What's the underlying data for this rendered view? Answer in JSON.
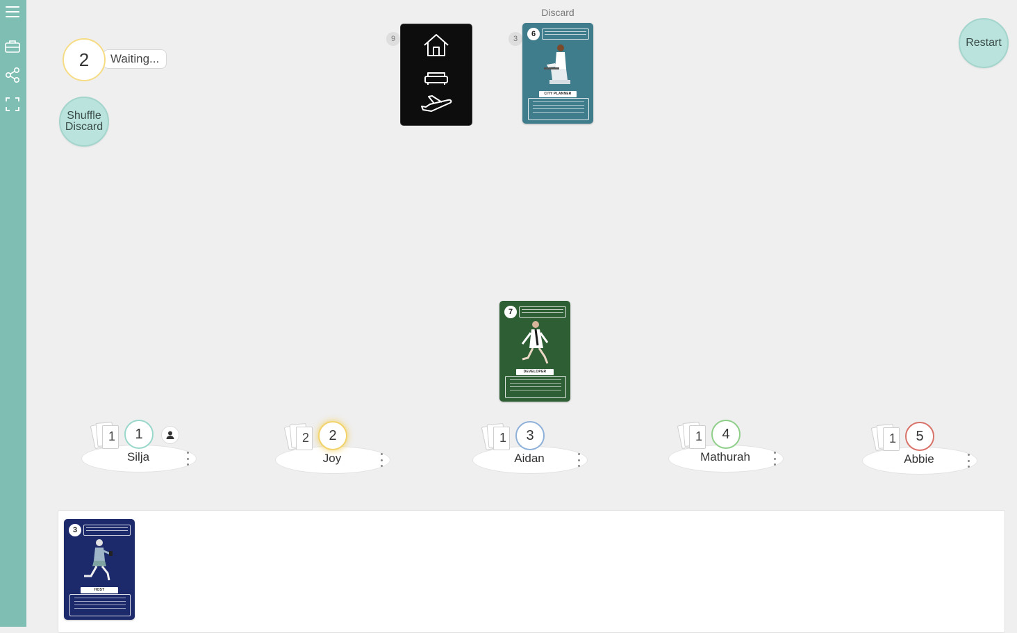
{
  "sidebar": {
    "icons": [
      "menu-icon",
      "briefcase-icon",
      "share-icon",
      "fullscreen-icon"
    ]
  },
  "turn": {
    "number": "2",
    "status": "Waiting..."
  },
  "shuffle_button": "Shuffle\nDiscard",
  "restart_button": "Restart",
  "deck": {
    "count": "9",
    "icons": [
      "house-icon",
      "sofa-icon",
      "airplane-icon"
    ]
  },
  "discard": {
    "label": "Discard",
    "count": "3",
    "card": {
      "number": "6",
      "role": "CITY PLANNER",
      "color": "#3f7c8c"
    }
  },
  "played_card": {
    "number": "7",
    "role": "DEVELOPER",
    "color": "#2e5e33"
  },
  "players": [
    {
      "name": "Silja",
      "cards": "1",
      "seat": "1",
      "ring": "#9ad8cc",
      "you": true
    },
    {
      "name": "Joy",
      "cards": "2",
      "seat": "2",
      "ring": "#f3d36b",
      "you": false
    },
    {
      "name": "Aidan",
      "cards": "1",
      "seat": "3",
      "ring": "#8fb1d9",
      "you": false
    },
    {
      "name": "Mathurah",
      "cards": "1",
      "seat": "4",
      "ring": "#8fcf8a",
      "you": false
    },
    {
      "name": "Abbie",
      "cards": "1",
      "seat": "5",
      "ring": "#d9736a",
      "you": false
    }
  ],
  "my_hand": [
    {
      "number": "3",
      "role": "HOST",
      "color": "#1c2a6b"
    }
  ],
  "colors": {
    "sidebar": "#7fbfb3",
    "button": "#b9e3dc",
    "background": "#efefef"
  }
}
